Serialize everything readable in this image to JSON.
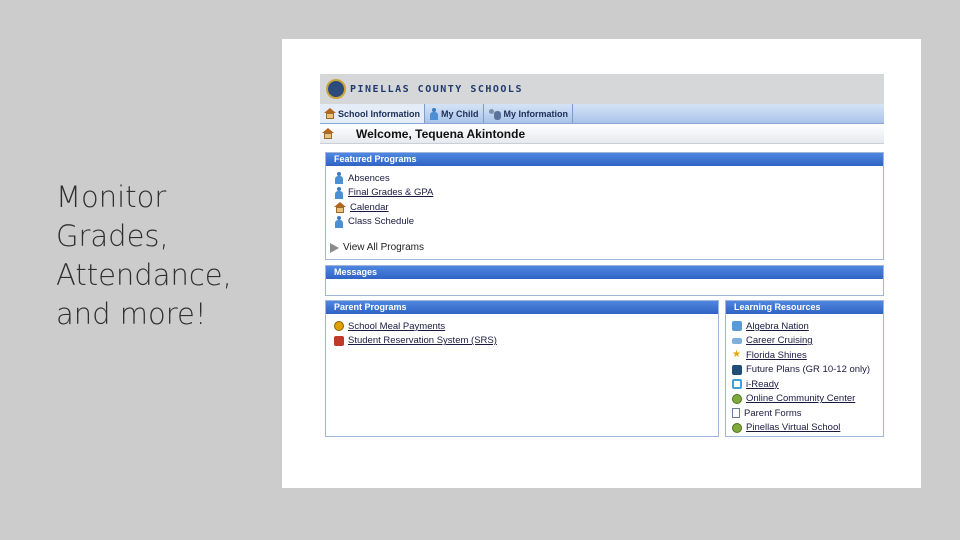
{
  "slide": {
    "heading_lines": [
      "Monitor",
      "Grades,",
      "Attendance,",
      "and more!"
    ]
  },
  "portal": {
    "logo_text": "PINELLAS COUNTY SCHOOLS",
    "tabs": [
      {
        "label": "School Information",
        "icon": "house-icon"
      },
      {
        "label": "My Child",
        "icon": "person-icon"
      },
      {
        "label": "My Information",
        "icon": "persons-icon"
      }
    ],
    "welcome": "Welcome, Tequena Akintonde",
    "featured": {
      "title": "Featured Programs",
      "items": [
        {
          "label": "Absences",
          "icon": "person-icon",
          "underline": false
        },
        {
          "label": "Final Grades & GPA",
          "icon": "person-icon",
          "underline": true
        },
        {
          "label": "Calendar",
          "icon": "house-icon",
          "underline": true
        },
        {
          "label": "Class Schedule",
          "icon": "person-icon",
          "underline": false
        }
      ],
      "view_all": "View All Programs"
    },
    "messages": {
      "title": "Messages"
    },
    "parent_programs": {
      "title": "Parent Programs",
      "items": [
        {
          "label": "School Meal Payments",
          "icon": "coin-icon",
          "underline": true
        },
        {
          "label": "Student Reservation System (SRS)",
          "icon": "school-icon",
          "underline": true
        }
      ]
    },
    "learning_resources": {
      "title": "Learning Resources",
      "items": [
        {
          "label": "Algebra Nation",
          "icon": "flag-icon",
          "underline": true
        },
        {
          "label": "Career Cruising",
          "icon": "banner-icon",
          "underline": true
        },
        {
          "label": "Florida Shines",
          "icon": "star-icon",
          "underline": true
        },
        {
          "label": "Future Plans (GR 10-12 only)",
          "icon": "book-icon",
          "underline": false
        },
        {
          "label": "i-Ready",
          "icon": "iready-icon",
          "underline": true
        },
        {
          "label": "Online Community Center",
          "icon": "globe-icon",
          "underline": true
        },
        {
          "label": "Parent Forms",
          "icon": "document-icon",
          "underline": false
        },
        {
          "label": "Pinellas Virtual School",
          "icon": "globe-icon",
          "underline": true
        }
      ]
    },
    "colors": {
      "panel_header": "#3a70d0",
      "tab_bar": "#b9cff0",
      "slide_background": "#cbcccb"
    }
  }
}
